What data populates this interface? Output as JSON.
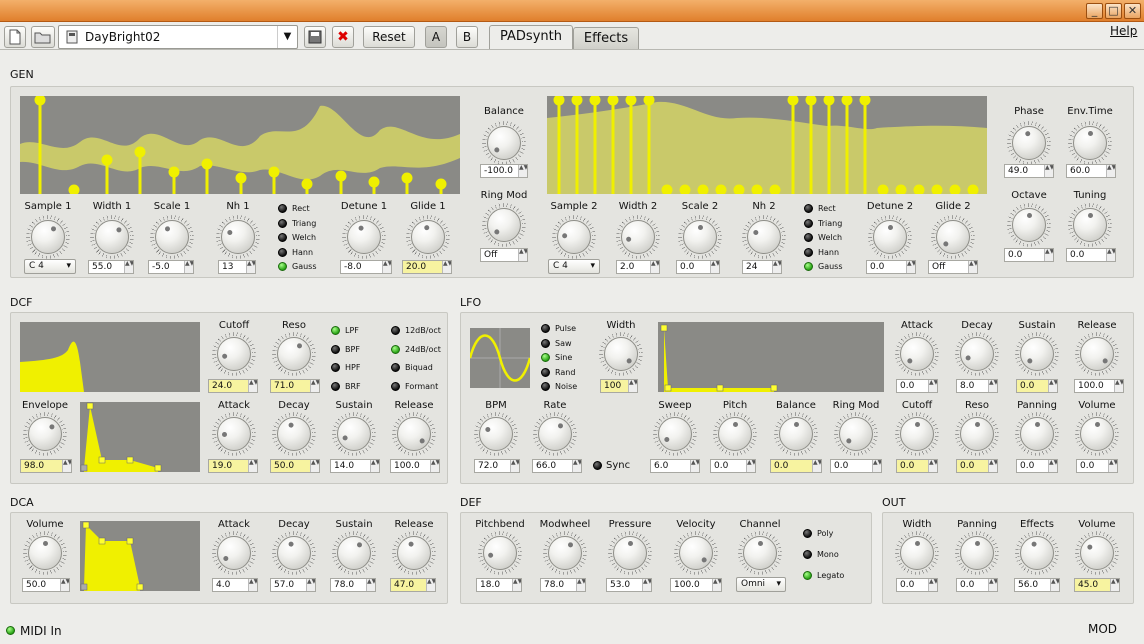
{
  "window": {
    "min": "_",
    "max": "□",
    "close": "✕"
  },
  "toolbar": {
    "preset_name": "DayBright02",
    "reset": "Reset",
    "a": "A",
    "b": "B",
    "help": "Help"
  },
  "tabs": [
    {
      "label": "PADsynth"
    },
    {
      "label": "Effects"
    }
  ],
  "sections": {
    "gen": "GEN",
    "dcf": "DCF",
    "lfo": "LFO",
    "dca": "DCA",
    "def": "DEF",
    "out": "OUT"
  },
  "gen": {
    "balance": {
      "label": "Balance",
      "value": "-100.0"
    },
    "ringmod": {
      "label": "Ring Mod",
      "value": "Off"
    },
    "phase": {
      "label": "Phase",
      "value": "49.0"
    },
    "envtime": {
      "label": "Env.Time",
      "value": "60.0"
    },
    "octave": {
      "label": "Octave",
      "value": "0.0"
    },
    "tuning": {
      "label": "Tuning",
      "value": "0.0"
    },
    "osc1": {
      "sample": {
        "label": "Sample 1",
        "value": "C 4"
      },
      "width": {
        "label": "Width 1",
        "value": "55.0"
      },
      "scale": {
        "label": "Scale 1",
        "value": "-5.0"
      },
      "nh": {
        "label": "Nh 1",
        "value": "13"
      },
      "detune": {
        "label": "Detune 1",
        "value": "-8.0"
      },
      "glide": {
        "label": "Glide 1",
        "value": "20.0"
      },
      "shapes": [
        {
          "label": "Rect",
          "on": false
        },
        {
          "label": "Triang",
          "on": false
        },
        {
          "label": "Welch",
          "on": false
        },
        {
          "label": "Hann",
          "on": false
        },
        {
          "label": "Gauss",
          "on": true
        }
      ]
    },
    "osc2": {
      "sample": {
        "label": "Sample 2",
        "value": "C 4"
      },
      "width": {
        "label": "Width 2",
        "value": "2.0"
      },
      "scale": {
        "label": "Scale 2",
        "value": "0.0"
      },
      "nh": {
        "label": "Nh 2",
        "value": "24"
      },
      "detune": {
        "label": "Detune 2",
        "value": "0.0"
      },
      "glide": {
        "label": "Glide 2",
        "value": "Off"
      },
      "shapes": [
        {
          "label": "Rect",
          "on": false
        },
        {
          "label": "Triang",
          "on": false
        },
        {
          "label": "Welch",
          "on": false
        },
        {
          "label": "Hann",
          "on": false
        },
        {
          "label": "Gauss",
          "on": true
        }
      ]
    }
  },
  "dcf": {
    "cutoff": {
      "label": "Cutoff",
      "value": "24.0"
    },
    "reso": {
      "label": "Reso",
      "value": "71.0"
    },
    "types": [
      {
        "label": "LPF",
        "on": true
      },
      {
        "label": "BPF",
        "on": false
      },
      {
        "label": "HPF",
        "on": false
      },
      {
        "label": "BRF",
        "on": false
      }
    ],
    "slopes": [
      {
        "label": "12dB/oct",
        "on": false
      },
      {
        "label": "24dB/oct",
        "on": true
      },
      {
        "label": "Biquad",
        "on": false
      },
      {
        "label": "Formant",
        "on": false
      }
    ],
    "envelope": {
      "label": "Envelope",
      "value": "98.0"
    },
    "attack": {
      "label": "Attack",
      "value": "19.0"
    },
    "decay": {
      "label": "Decay",
      "value": "50.0"
    },
    "sustain": {
      "label": "Sustain",
      "value": "14.0"
    },
    "release": {
      "label": "Release",
      "value": "100.0"
    }
  },
  "lfo": {
    "waves": [
      {
        "label": "Pulse",
        "on": false
      },
      {
        "label": "Saw",
        "on": false
      },
      {
        "label": "Sine",
        "on": true
      },
      {
        "label": "Rand",
        "on": false
      },
      {
        "label": "Noise",
        "on": false
      }
    ],
    "width": {
      "label": "Width",
      "value": "100"
    },
    "attack": {
      "label": "Attack",
      "value": "0.0"
    },
    "decay": {
      "label": "Decay",
      "value": "8.0"
    },
    "sustain": {
      "label": "Sustain",
      "value": "0.0"
    },
    "release": {
      "label": "Release",
      "value": "100.0"
    },
    "bpm": {
      "label": "BPM",
      "value": "72.0"
    },
    "rate": {
      "label": "Rate",
      "value": "66.0"
    },
    "sync": {
      "label": "Sync"
    },
    "sweep": {
      "label": "Sweep",
      "value": "6.0"
    },
    "pitch": {
      "label": "Pitch",
      "value": "0.0"
    },
    "balance": {
      "label": "Balance",
      "value": "0.0"
    },
    "ringmod": {
      "label": "Ring Mod",
      "value": "0.0"
    },
    "cutoff": {
      "label": "Cutoff",
      "value": "0.0"
    },
    "reso": {
      "label": "Reso",
      "value": "0.0"
    },
    "panning": {
      "label": "Panning",
      "value": "0.0"
    },
    "volume": {
      "label": "Volume",
      "value": "0.0"
    }
  },
  "dca": {
    "volume": {
      "label": "Volume",
      "value": "50.0"
    },
    "attack": {
      "label": "Attack",
      "value": "4.0"
    },
    "decay": {
      "label": "Decay",
      "value": "57.0"
    },
    "sustain": {
      "label": "Sustain",
      "value": "78.0"
    },
    "release": {
      "label": "Release",
      "value": "47.0"
    }
  },
  "def": {
    "pitchbend": {
      "label": "Pitchbend",
      "value": "18.0"
    },
    "modwheel": {
      "label": "Modwheel",
      "value": "78.0"
    },
    "pressure": {
      "label": "Pressure",
      "value": "53.0"
    },
    "velocity": {
      "label": "Velocity",
      "value": "100.0"
    },
    "channel": {
      "label": "Channel",
      "value": "Omni"
    },
    "modes": [
      {
        "label": "Poly",
        "on": false
      },
      {
        "label": "Mono",
        "on": false
      },
      {
        "label": "Legato",
        "on": true
      }
    ]
  },
  "out": {
    "width": {
      "label": "Width",
      "value": "0.0"
    },
    "panning": {
      "label": "Panning",
      "value": "0.0"
    },
    "effects": {
      "label": "Effects",
      "value": "56.0"
    },
    "volume": {
      "label": "Volume",
      "value": "45.0"
    }
  },
  "status": {
    "midi_in": "MIDI In",
    "mod": "MOD"
  },
  "colors": {
    "accent": "#f0f000",
    "wave": "#c9c96a",
    "graph_bg": "#8a8a86",
    "highlight": "#f7f3a0",
    "led_on": "#2aa416"
  }
}
